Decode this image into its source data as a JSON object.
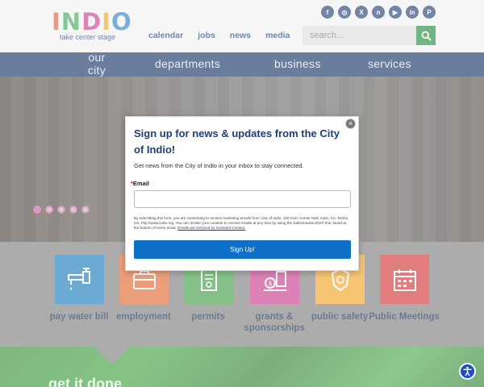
{
  "header": {
    "logo_word": [
      "I",
      "N",
      "D",
      "I",
      "O"
    ],
    "logo_tagline": "take center stage",
    "social": [
      {
        "name": "facebook",
        "glyph": "f"
      },
      {
        "name": "instagram",
        "glyph": "◎"
      },
      {
        "name": "twitter-x",
        "glyph": "X"
      },
      {
        "name": "nextdoor",
        "glyph": "n"
      },
      {
        "name": "youtube",
        "glyph": "▶"
      },
      {
        "name": "linkedin",
        "glyph": "in"
      },
      {
        "name": "pinterest",
        "glyph": "P"
      }
    ],
    "top_links": [
      "calendar",
      "jobs",
      "news",
      "media"
    ],
    "search": {
      "placeholder": "search..."
    }
  },
  "main_nav": {
    "items": [
      "our city",
      "departments",
      "business",
      "services"
    ]
  },
  "hero": {
    "slides": 5,
    "active_slide": 1
  },
  "tiles": [
    {
      "label": "pay water bill",
      "color": "#1177b8",
      "icon": "faucet-icon"
    },
    {
      "label": "employment",
      "color": "#e0632a",
      "icon": "briefcase-icon"
    },
    {
      "label": "permits",
      "color": "#3a9a3f",
      "icon": "document-icon"
    },
    {
      "label": "grants & sponsorships",
      "color": "#c7358a",
      "icon": "grant-icon"
    },
    {
      "label": "public safety",
      "color": "#f0a21d",
      "icon": "badge-icon"
    },
    {
      "label": "Public Meetings",
      "color": "#cf2e2e",
      "icon": "calendar-icon"
    }
  ],
  "footer": {
    "heading": "get it done"
  },
  "modal": {
    "title": "Sign up for news & updates from the City of Indio!",
    "subtitle": "Get news from the City of Indio in your inbox to stay connected.",
    "email_label": "Email",
    "required_mark": "*",
    "legal": "By submitting this form, you are consenting to receive marketing emails from: City of Indio, 100 Civic Center Mall, Indio, CA, 92201, US, http://www.indio.org. You can revoke your consent to receive emails at any time by using the SafeUnsubscribe® link, found at the bottom of every email.",
    "legal_link": "Emails are serviced by Constant Contact.",
    "button": "Sign Up!",
    "close": "×"
  }
}
